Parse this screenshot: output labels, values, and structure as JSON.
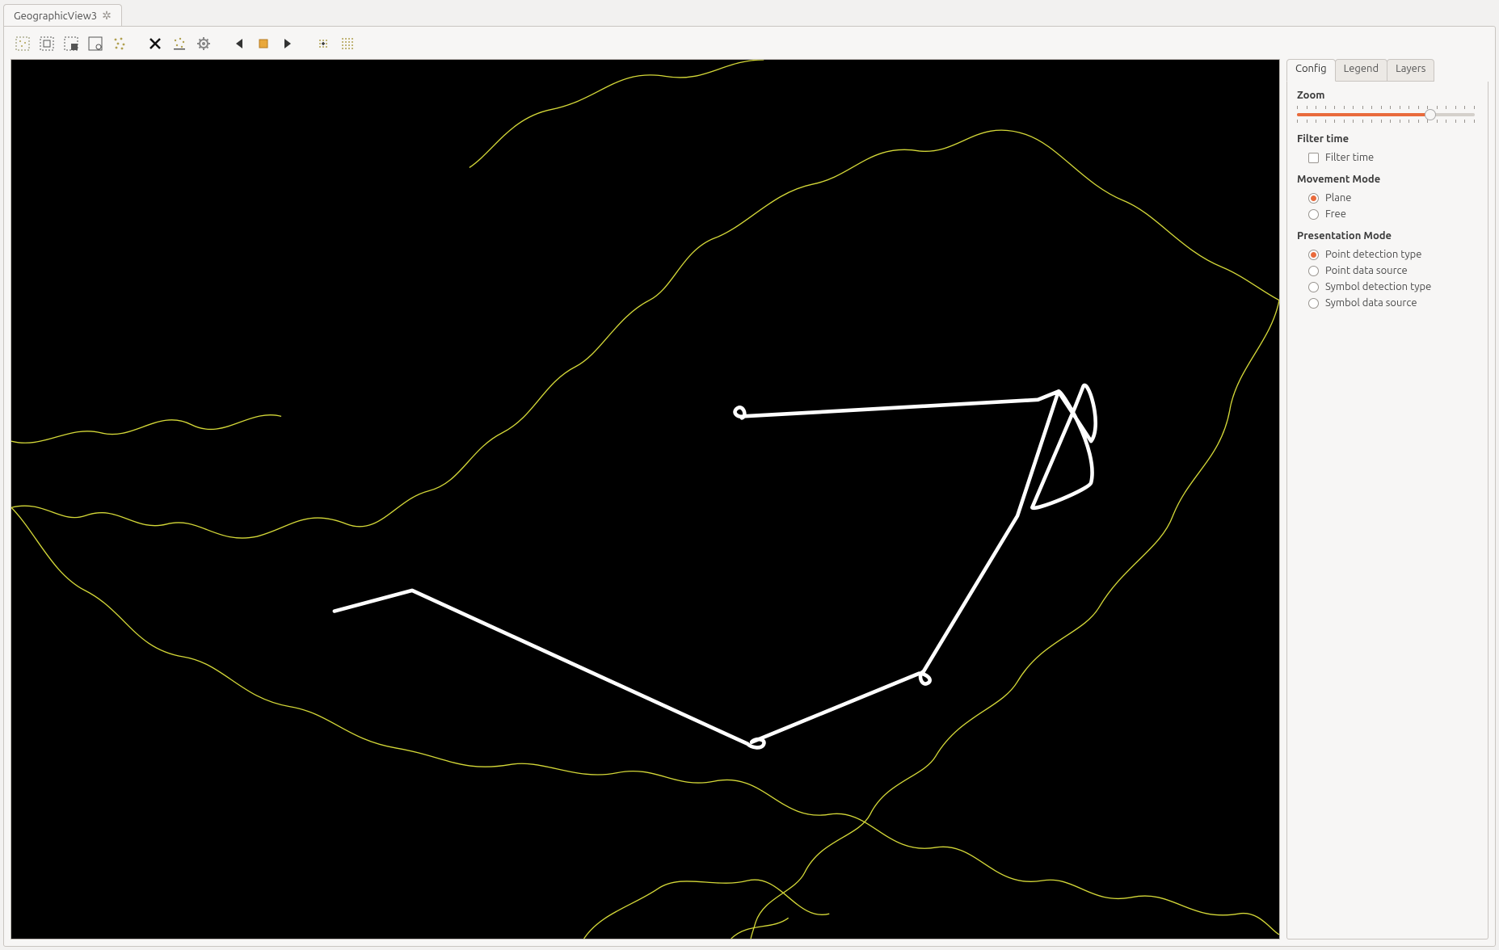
{
  "window": {
    "tab_title": "GeographicView3"
  },
  "toolbar": {
    "buttons": [
      "select-area",
      "select-rect",
      "select-add",
      "select-invert",
      "select-scatter",
      "clear-x",
      "scatter-points",
      "gear-settings",
      "play-back",
      "stop",
      "play-forward",
      "grid-add",
      "grid-all"
    ]
  },
  "side": {
    "tabs": {
      "config": "Config",
      "legend": "Legend",
      "layers": "Layers",
      "active": "config"
    },
    "zoom": {
      "title": "Zoom",
      "value_pct": 75,
      "ticks": 20
    },
    "filter_time": {
      "title": "Filter time",
      "checkbox_label": "Filter time",
      "checked": false
    },
    "movement_mode": {
      "title": "Movement Mode",
      "options": [
        {
          "label": "Plane",
          "checked": true
        },
        {
          "label": "Free",
          "checked": false
        }
      ]
    },
    "presentation_mode": {
      "title": "Presentation Mode",
      "options": [
        {
          "label": "Point detection type",
          "checked": true
        },
        {
          "label": "Point data source",
          "checked": false
        },
        {
          "label": "Symbol detection type",
          "checked": false
        },
        {
          "label": "Symbol data source",
          "checked": false
        }
      ]
    }
  },
  "colors": {
    "accent": "#e96b3c",
    "border_yellow": "#d4d838",
    "track_white": "#ffffff"
  }
}
